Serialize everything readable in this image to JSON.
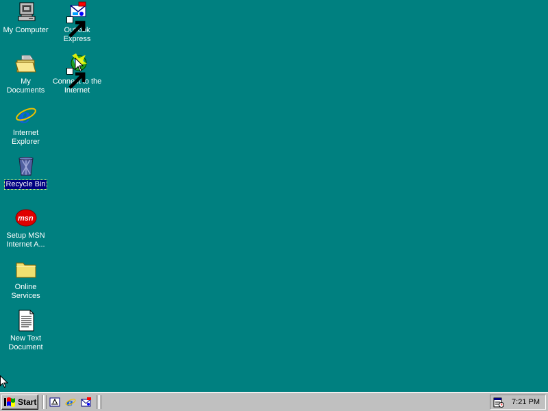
{
  "desktop": {
    "background": "#008080",
    "icons": [
      {
        "label": "My Computer",
        "icon": "my-computer-icon"
      },
      {
        "label": "Outlook Express",
        "icon": "outlook-express-icon"
      },
      {
        "label": "My Documents",
        "icon": "my-documents-icon"
      },
      {
        "label": "Connect to the Internet",
        "icon": "connect-internet-icon"
      },
      {
        "label": "Internet Explorer",
        "icon": "internet-explorer-icon"
      },
      {
        "label": "Recycle Bin",
        "icon": "recycle-bin-icon",
        "selected": true
      },
      {
        "label": "Setup MSN Internet A...",
        "icon": "msn-icon"
      },
      {
        "label": "Online Services",
        "icon": "folder-icon"
      },
      {
        "label": "New Text Document",
        "icon": "text-document-icon"
      }
    ]
  },
  "taskbar": {
    "start_label": "Start",
    "quick_launch": [
      "show-desktop-icon",
      "ie-quicklaunch-icon",
      "outlook-quicklaunch-icon"
    ],
    "tray": {
      "time": "7:21 PM",
      "icons": [
        "scheduler-tray-icon"
      ]
    }
  }
}
